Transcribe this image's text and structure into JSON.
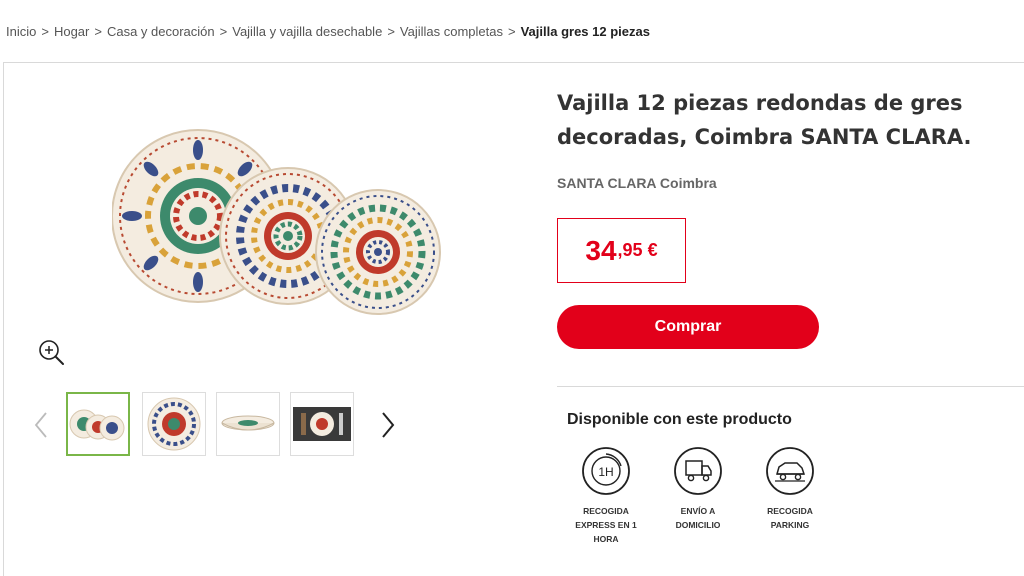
{
  "breadcrumb": {
    "items": [
      "Inicio",
      "Hogar",
      "Casa y decoración",
      "Vajilla y vajilla desechable",
      "Vajillas completas"
    ],
    "current": "Vajilla gres 12 piezas",
    "separator": ">"
  },
  "product": {
    "title": "Vajilla 12 piezas redondas de gres decoradas, Coimbra SANTA CLARA.",
    "brand": "SANTA CLARA Coimbra",
    "price_int": "34",
    "price_dec": ",95 €",
    "buy_label": "Comprar"
  },
  "gallery": {
    "thumbnails": [
      "thumb-set",
      "thumb-plate",
      "thumb-bowl",
      "thumb-table"
    ],
    "active_index": 0
  },
  "availability": {
    "title": "Disponible con este producto",
    "services": [
      {
        "icon": "express-1h-icon",
        "label": "RECOGIDA EXPRESS EN 1 HORA"
      },
      {
        "icon": "delivery-truck-icon",
        "label": "ENVÍO A DOMICILIO"
      },
      {
        "icon": "parking-car-icon",
        "label": "RECOGIDA PARKING"
      }
    ]
  },
  "colors": {
    "accent": "#e2001a",
    "thumb_active": "#7ab648"
  }
}
